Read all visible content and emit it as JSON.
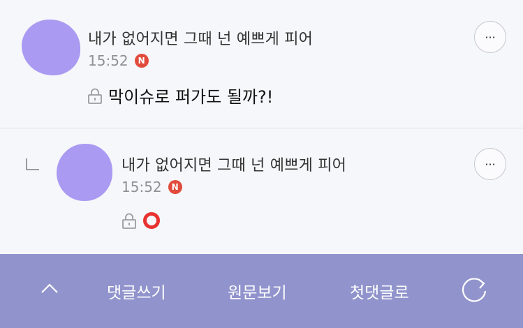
{
  "comments": [
    {
      "nickname": "내가 없어지면 그때 넌 예쁘게 피어",
      "time": "15:52",
      "badge": "N",
      "text": "막이슈로 퍼가도 될까?!",
      "more": "···"
    },
    {
      "nickname": "내가 없어지면 그때 넌 예쁘게 피어",
      "time": "15:52",
      "badge": "N",
      "text": "",
      "more": "···",
      "is_reply": true
    }
  ],
  "bottom_bar": {
    "write_comment": "댓글쓰기",
    "view_original": "원문보기",
    "first_comment": "첫댓글로",
    "colors": {
      "bar": "#9194cc",
      "badge": "#e14b3c",
      "circle": "#e8322f",
      "avatar": "#aa9af2"
    }
  }
}
